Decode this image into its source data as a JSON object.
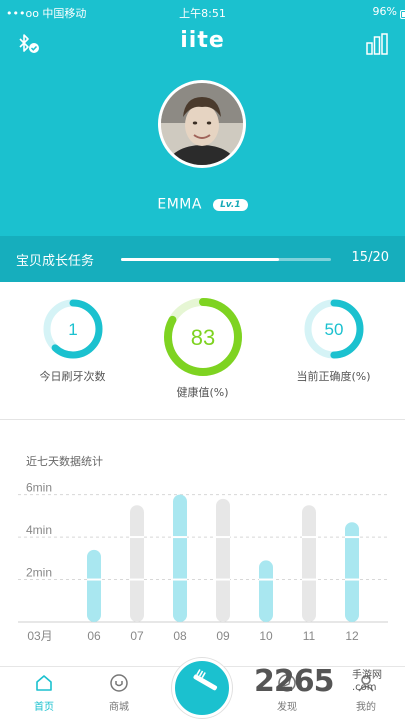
{
  "status_bar": {
    "carrier": "•••oo 中国移动",
    "time": "上午8:51",
    "battery": "96%"
  },
  "header": {
    "app_title": "iite",
    "bluetooth_icon": "bluetooth-connected-icon",
    "stats_icon": "bar-chart-icon"
  },
  "profile": {
    "name": "EMMA",
    "level": "Lv.1"
  },
  "task": {
    "label": "宝贝成长任务",
    "count": "15/20",
    "progress": 0.75
  },
  "rings": [
    {
      "value": "1",
      "caption": "今日刷牙次数",
      "fraction": 0.62,
      "color": "#1bc1cf"
    },
    {
      "value": "83",
      "caption": "健康值(%)",
      "fraction": 0.83,
      "color": "#7ed321"
    },
    {
      "value": "50",
      "caption": "当前正确度(%)",
      "fraction": 0.5,
      "color": "#1bc1cf"
    }
  ],
  "chart_title": "近七天数据统计",
  "chart_data": {
    "type": "bar",
    "title": "近七天数据统计",
    "categories": [
      "03月",
      "06",
      "07",
      "08",
      "09",
      "10",
      "11",
      "12"
    ],
    "y_ticks": [
      "2min",
      "4min",
      "6min"
    ],
    "ylim": [
      0,
      6.5
    ],
    "unit": "min",
    "series": [
      {
        "name": "",
        "color": "#a9e7f0",
        "values": [
          null,
          3.4,
          null,
          6.0,
          null,
          2.9,
          null,
          4.7
        ]
      },
      {
        "name": "",
        "color": "#e7e7e7",
        "values": [
          null,
          null,
          5.5,
          null,
          5.8,
          null,
          5.5,
          null
        ]
      }
    ],
    "grid": true
  },
  "tabs": [
    {
      "label": "首页",
      "icon": "home-icon"
    },
    {
      "label": "商城",
      "icon": "shop-icon"
    },
    {
      "label": "",
      "icon": "toothbrush-icon"
    },
    {
      "label": "发现",
      "icon": "compass-icon"
    },
    {
      "label": "我的",
      "icon": "user-icon"
    }
  ],
  "watermark": {
    "number": "2265",
    "text": "手游网",
    "domain": ".com"
  }
}
